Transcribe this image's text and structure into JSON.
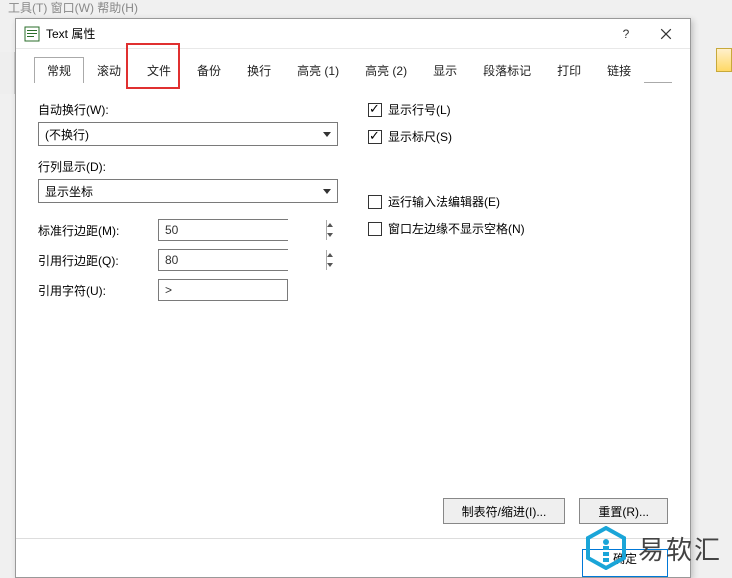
{
  "menu_fragment": "工具(T)   窗口(W)   帮助(H)",
  "dialog": {
    "title": "Text 属性",
    "help_symbol": "?",
    "close_symbol": "×"
  },
  "tabs": {
    "general": "常规",
    "scroll": "滚动",
    "file": "文件",
    "backup": "备份",
    "wrap": "换行",
    "highlight1": "高亮 (1)",
    "highlight2": "高亮 (2)",
    "display": "显示",
    "paragraph": "段落标记",
    "print": "打印",
    "link": "链接"
  },
  "left": {
    "auto_wrap_label": "自动换行(W):",
    "auto_wrap_value": "(不换行)",
    "rowcol_label": "行列显示(D):",
    "rowcol_value": "显示坐标",
    "std_margin_label": "标准行边距(M):",
    "std_margin_value": "50",
    "quote_margin_label": "引用行边距(Q):",
    "quote_margin_value": "80",
    "quote_char_label": "引用字符(U):",
    "quote_char_value": ">"
  },
  "right": {
    "show_line_no": "显示行号(L)",
    "show_ruler": "显示标尺(S)",
    "run_ime": "运行输入法编辑器(E)",
    "hide_left_spaces": "窗口左边缘不显示空格(N)",
    "checked": {
      "show_line_no": true,
      "show_ruler": true,
      "run_ime": false,
      "hide_left_spaces": false
    }
  },
  "buttons": {
    "tab_indent": "制表符/缩进(I)...",
    "reset": "重置(R)...",
    "ok": "确定"
  },
  "brand": "易软汇"
}
